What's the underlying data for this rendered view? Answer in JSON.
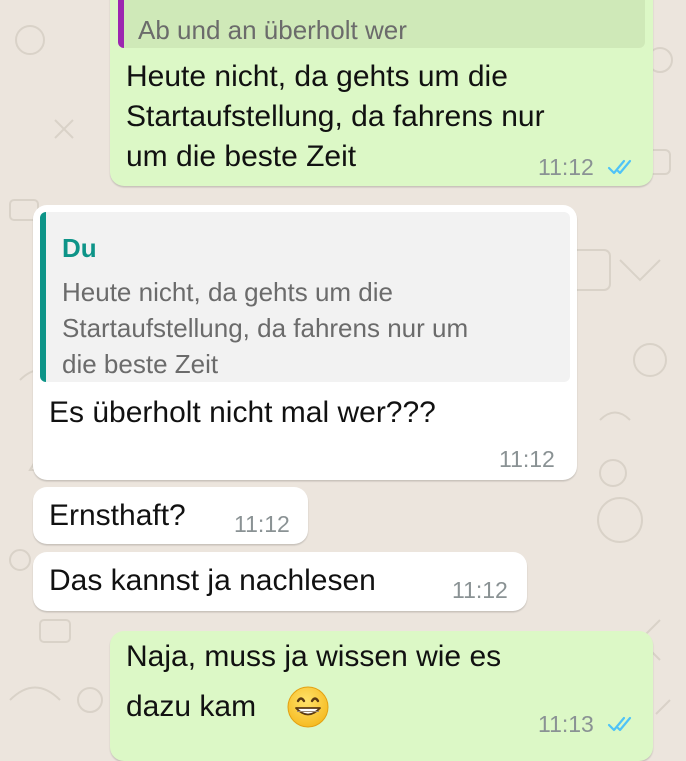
{
  "colors": {
    "chat_background": "#ece5dd",
    "outgoing_bubble": "#dcf8c6",
    "incoming_bubble": "#ffffff",
    "read_ticks": "#4fc3f7",
    "quote_bar_outgoing": "#9c27b0",
    "quote_bar_incoming": "#0d9488",
    "quote_author": "#0d9488"
  },
  "messages": [
    {
      "direction": "outgoing",
      "quote": {
        "text": "Ab und an überholt wer"
      },
      "lines": [
        "Heute nicht, da gehts um die",
        "Startaufstellung, da fahrens nur",
        "um die beste Zeit"
      ],
      "time": "11:12",
      "status_icon": "double-check-read-icon"
    },
    {
      "direction": "incoming",
      "quote": {
        "author": "Du",
        "lines": [
          "Heute nicht, da gehts um die",
          "Startaufstellung, da fahrens nur um",
          "die beste Zeit"
        ]
      },
      "lines": [
        "Es überholt nicht mal wer???"
      ],
      "time": "11:12"
    },
    {
      "direction": "incoming",
      "lines": [
        "Ernsthaft?"
      ],
      "time": "11:12"
    },
    {
      "direction": "incoming",
      "lines": [
        "Das kannst ja nachlesen"
      ],
      "time": "11:12"
    },
    {
      "direction": "outgoing",
      "lines": [
        "Naja, muss ja wissen wie es",
        "dazu kam"
      ],
      "emoji": "grinning-face-icon",
      "time": "11:13",
      "status_icon": "double-check-read-icon"
    }
  ]
}
